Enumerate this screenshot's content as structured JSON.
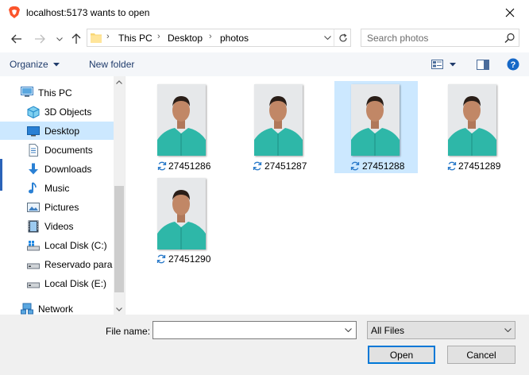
{
  "window": {
    "title": "localhost:5173 wants to open",
    "brand_color": "#fb542b"
  },
  "address": {
    "breadcrumbs": [
      "This PC",
      "Desktop",
      "photos"
    ]
  },
  "search": {
    "placeholder": "Search photos"
  },
  "toolbar": {
    "organize_label": "Organize",
    "new_folder_label": "New folder"
  },
  "nav": {
    "items": [
      {
        "label": "This PC",
        "icon": "computer-icon"
      },
      {
        "label": "3D Objects",
        "icon": "3d-objects-icon"
      },
      {
        "label": "Desktop",
        "icon": "desktop-icon",
        "selected": true
      },
      {
        "label": "Documents",
        "icon": "documents-icon"
      },
      {
        "label": "Downloads",
        "icon": "downloads-icon"
      },
      {
        "label": "Music",
        "icon": "music-icon"
      },
      {
        "label": "Pictures",
        "icon": "pictures-icon"
      },
      {
        "label": "Videos",
        "icon": "videos-icon"
      },
      {
        "label": "Local Disk (C:)",
        "icon": "windows-drive-icon"
      },
      {
        "label": "Reservado para e",
        "icon": "drive-icon"
      },
      {
        "label": "Local Disk (E:)",
        "icon": "drive-icon"
      },
      {
        "label": "Network",
        "icon": "network-icon"
      }
    ]
  },
  "files": [
    {
      "name": "27451286",
      "selected": false
    },
    {
      "name": "27451287",
      "selected": false
    },
    {
      "name": "27451288",
      "selected": true
    },
    {
      "name": "27451289",
      "selected": false
    },
    {
      "name": "27451290",
      "selected": false
    }
  ],
  "footer": {
    "file_name_label": "File name:",
    "file_name_value": "",
    "filter_value": "All Files",
    "open_label": "Open",
    "cancel_label": "Cancel"
  },
  "colors": {
    "selection": "#cce8ff",
    "accent": "#0078d7",
    "sync_icon": "#2a7ac9"
  }
}
